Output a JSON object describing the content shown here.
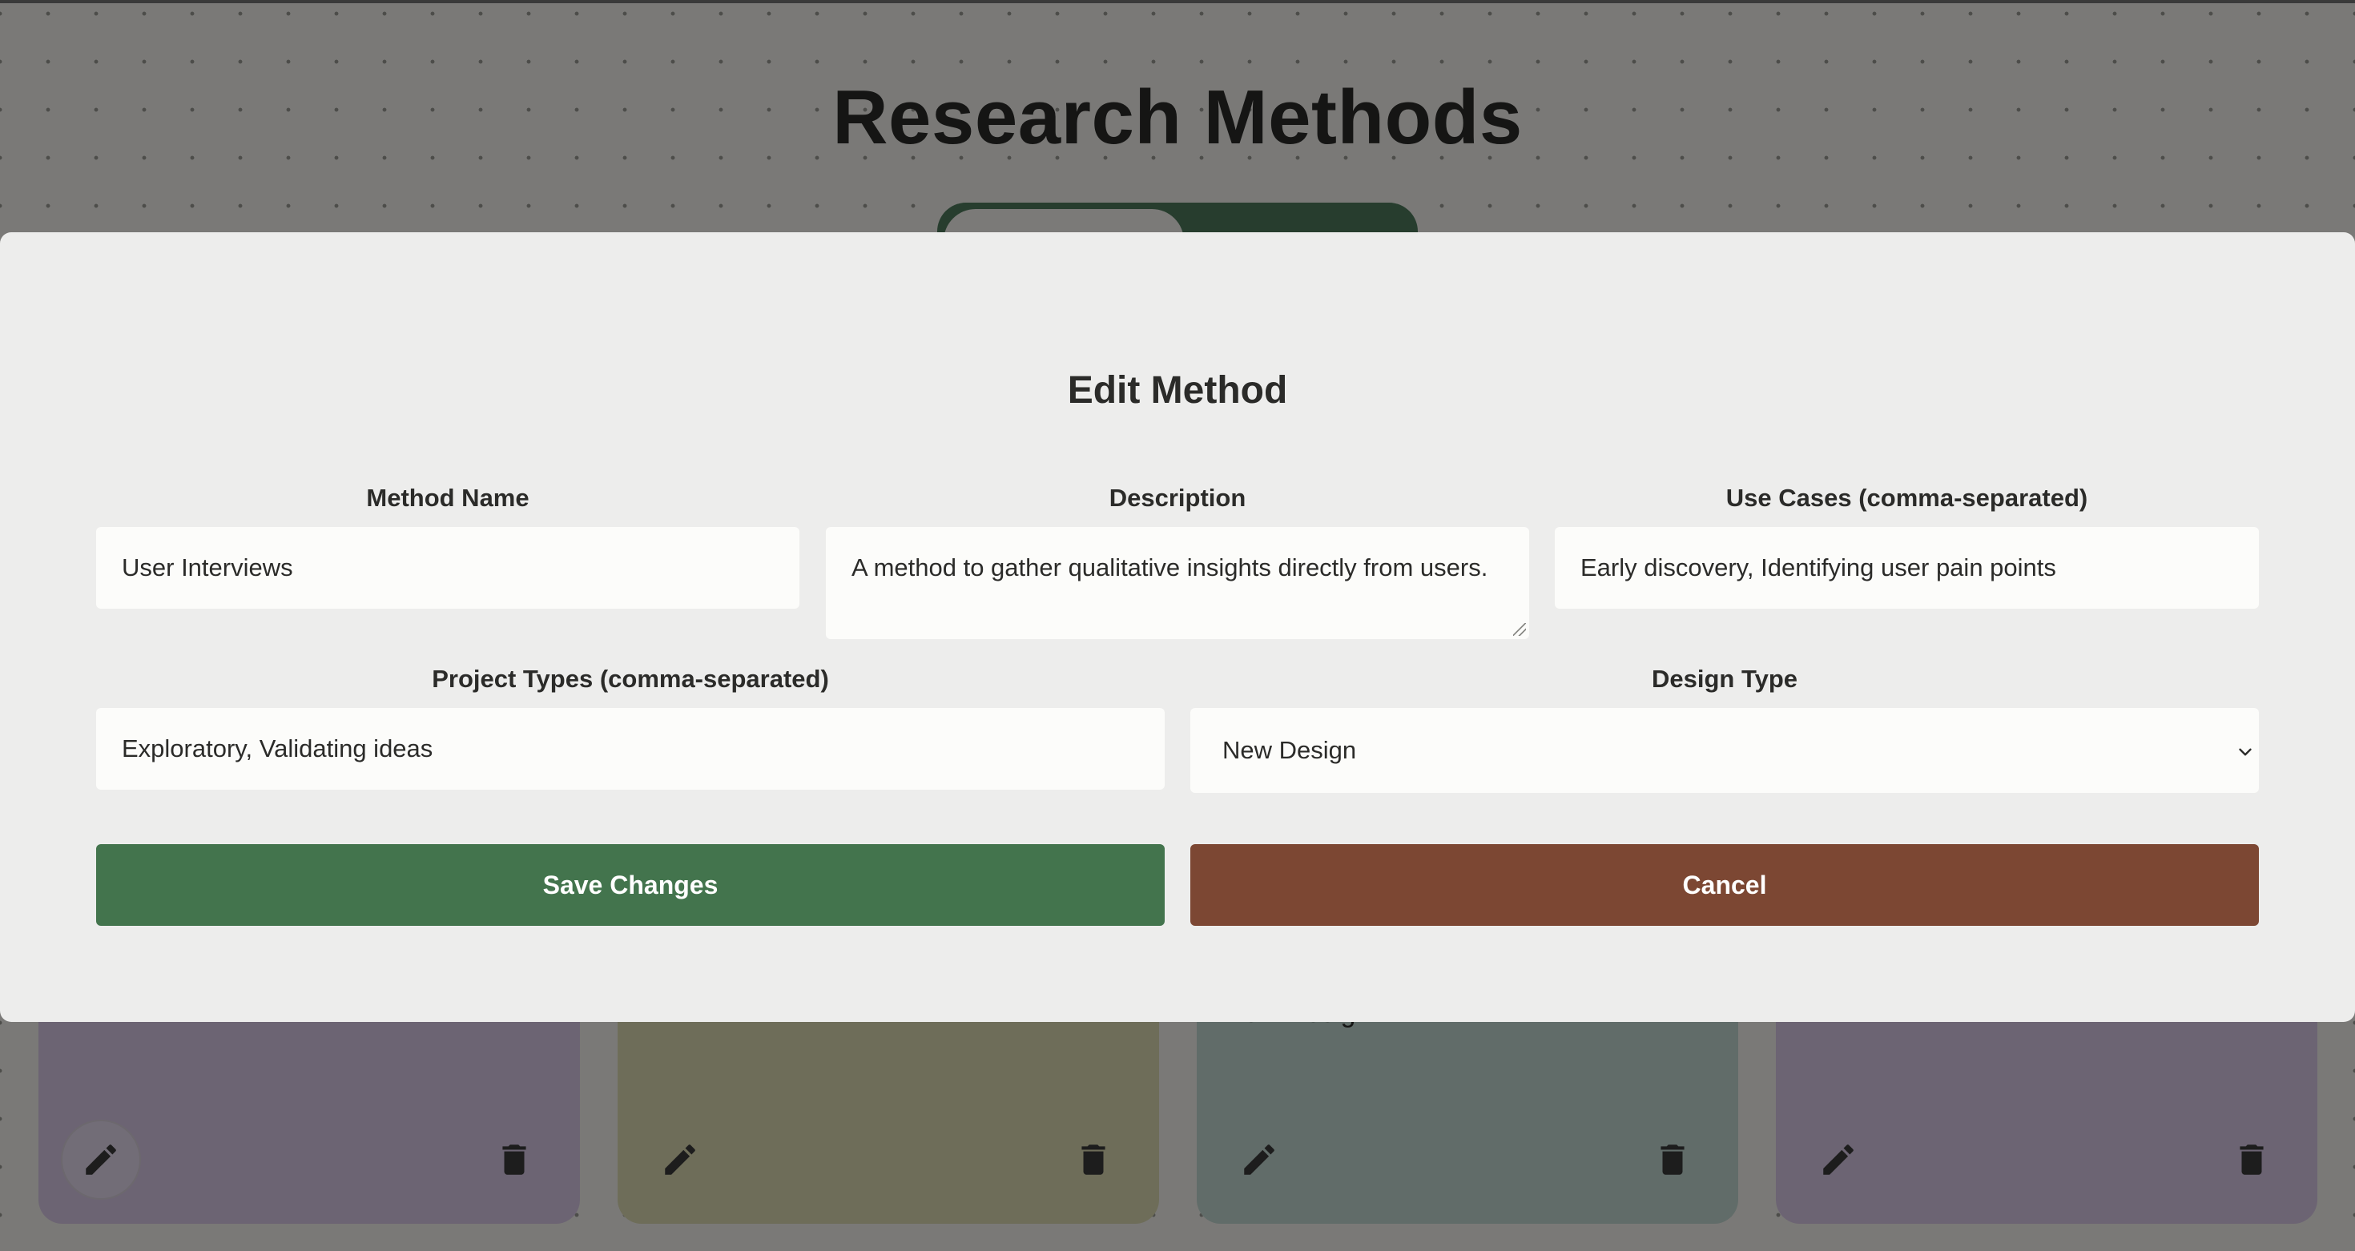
{
  "page": {
    "title": "Research Methods"
  },
  "cards": [
    {
      "text": ""
    },
    {
      "text": ""
    },
    {
      "text": "New Design"
    },
    {
      "text": ""
    }
  ],
  "modal": {
    "title": "Edit Method",
    "fields": {
      "method_name": {
        "label": "Method Name",
        "value": "User Interviews"
      },
      "description": {
        "label": "Description",
        "value": "A method to gather qualitative insights directly from users."
      },
      "use_cases": {
        "label": "Use Cases (comma-separated)",
        "value": "Early discovery, Identifying user pain points"
      },
      "project_types": {
        "label": "Project Types (comma-separated)",
        "value": "Exploratory, Validating ideas"
      },
      "design_type": {
        "label": "Design Type",
        "value": "New Design"
      }
    },
    "buttons": {
      "save_label": "Save Changes",
      "cancel_label": "Cancel"
    }
  },
  "colors": {
    "save": "#43744d",
    "cancel": "#7c4733",
    "modal_bg": "#ededec",
    "card_purple": "#d9c9e6",
    "card_olive": "#dcdbb3",
    "card_teal": "#c3d9d3"
  },
  "icons": {
    "edit": "pencil-icon",
    "delete": "trash-icon",
    "select": "chevron-down-icon"
  }
}
